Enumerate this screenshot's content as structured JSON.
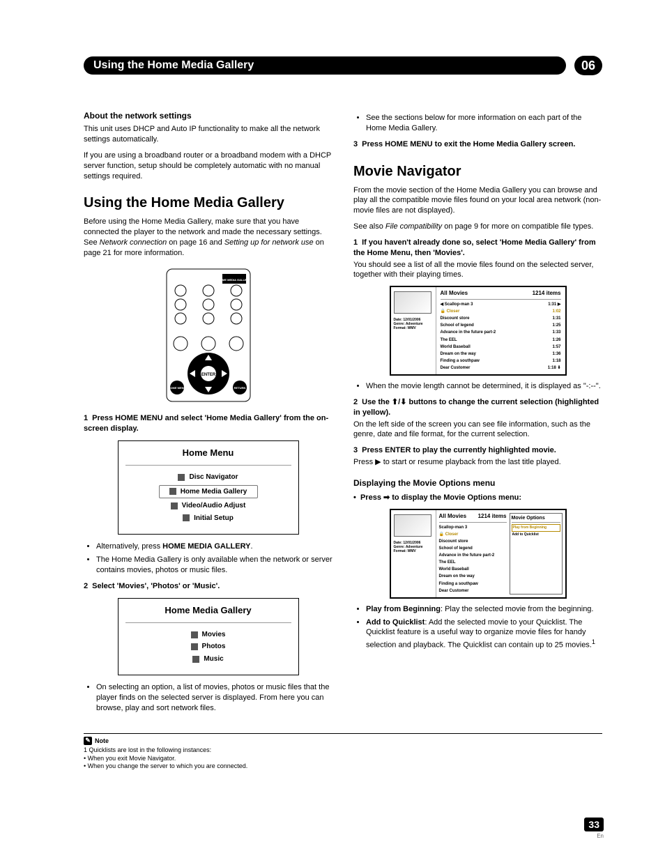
{
  "header": {
    "chapter_title": "Using the Home Media Gallery",
    "chapter_number": "06"
  },
  "left": {
    "about_heading": "About the network settings",
    "about_p1": "This unit uses DHCP and Auto IP functionality to make all the network settings automatically.",
    "about_p2": "If you are using a broadband router or a broadband modem with a DHCP server function, setup should be completely automatic with no manual settings required.",
    "using_heading": "Using the Home Media Gallery",
    "using_p1_a": "Before using the Home Media Gallery, make sure that you have connected the player to the network and made the necessary settings. See ",
    "using_p1_b": "Network connection",
    "using_p1_c": " on page 16 and ",
    "using_p1_d": "Setting up for network use",
    "using_p1_e": " on page 21 for more information.",
    "step1_num": "1",
    "step1": "Press HOME MENU and select 'Home Media Gallery' from the on-screen display.",
    "home_menu": {
      "title": "Home Menu",
      "items": [
        "Disc Navigator",
        "Home Media Gallery",
        "Video/Audio Adjust",
        "Initial Setup"
      ]
    },
    "alt_a": "Alternatively, press ",
    "alt_b": "HOME MEDIA GALLERY",
    "alt_c": ".",
    "only_when": "The Home Media Gallery is only available when the network or server contains movies, photos or music files.",
    "step2_num": "2",
    "step2": "Select 'Movies', 'Photos' or 'Music'.",
    "hmg_menu": {
      "title": "Home Media Gallery",
      "items": [
        "Movies",
        "Photos",
        "Music"
      ]
    },
    "on_selecting": "On selecting an option, a list of movies, photos or music files that the player finds on the selected server is displayed. From here you can browse, play and sort network files."
  },
  "right": {
    "see_sections": "See the sections below for more information on each part of the Home Media Gallery.",
    "step3_num": "3",
    "step3": "Press HOME MENU to exit the Home Media Gallery screen.",
    "movie_nav_heading": "Movie Navigator",
    "movie_nav_p1": "From the movie section of the Home Media Gallery you can browse and play all the compatible movie files found on your local area network (non-movie files are not displayed).",
    "movie_nav_p2_a": "See also ",
    "movie_nav_p2_b": "File compatibility",
    "movie_nav_p2_c": " on page 9 for more on compatible file types.",
    "mstep1_num": "1",
    "mstep1": "If you haven't already done so, select 'Home Media Gallery' from the Home Menu, then 'Movies'.",
    "mstep1_p": "You should see a list of all the movie files found on the selected server, together with their playing times.",
    "movie_list": {
      "title": "All Movies",
      "count": "1214 items",
      "meta": [
        "Date: 12/01/2006",
        "Genre: Adventure",
        "Format: WMV"
      ],
      "rows": [
        {
          "name": "Scallop-man 3",
          "time": "1:31"
        },
        {
          "name": "Closer",
          "time": "1:02"
        },
        {
          "name": "Discount store",
          "time": "1:31"
        },
        {
          "name": "School of legend",
          "time": "1:25"
        },
        {
          "name": "Advance in the future part-2",
          "time": "1:33"
        },
        {
          "name": "The EEL",
          "time": "1:26"
        },
        {
          "name": "World Baseball",
          "time": "1:57"
        },
        {
          "name": "Dream on the way",
          "time": "1:36"
        },
        {
          "name": "Finding a southpaw",
          "time": "1:18"
        },
        {
          "name": "Dear Customer",
          "time": "1:18"
        }
      ]
    },
    "cannot_determine": "When the movie length cannot be determined, it is displayed as \"-:--\".",
    "mstep2_num": "2",
    "mstep2_a": "Use the ",
    "mstep2_b": " buttons to change the current selection (highlighted in yellow).",
    "mstep2_p": "On the left side of the screen you can see file information, such as the genre, date and file format, for the current selection.",
    "mstep3_num": "3",
    "mstep3": "Press ENTER to play the currently highlighted movie.",
    "mstep3_p": "Press ▶ to start or resume playback from the last title played.",
    "options_heading": "Displaying the Movie Options menu",
    "options_bullet": "Press ➡ to display the Movie Options menu:",
    "options_box": {
      "title": "All Movies",
      "count": "1214 items",
      "meta": [
        "Date: 12/01/2006",
        "Genre: Adventure",
        "Format: WMV"
      ],
      "list": [
        "Scallop-man 3",
        "Closer",
        "Discount store",
        "School of legend",
        "Advance in the future part-2",
        "The EEL",
        "World Baseball",
        "Dream on the way",
        "Finding a southpaw",
        "Dear Customer"
      ],
      "menu_title": "Movie Options",
      "menu_items": [
        "Play from Beginning",
        "Add to Quicklist"
      ]
    },
    "opt1_label": "Play from Beginning",
    "opt1_text": ": Play the selected movie from the beginning.",
    "opt2_label": "Add to Quicklist",
    "opt2_text_a": ": Add the selected movie to your Quicklist. The Quicklist feature is a useful way to organize movie files for handy selection and playback. The Quicklist can contain up to 25 movies.",
    "opt2_sup": "1"
  },
  "footer": {
    "note_label": "Note",
    "fn1": "1 Quicklists are lost in the following instances:",
    "fn1a": "When you exit Movie Navigator.",
    "fn1b": "When you change the server to which you are connected.",
    "page_number": "33",
    "lang": "En"
  }
}
